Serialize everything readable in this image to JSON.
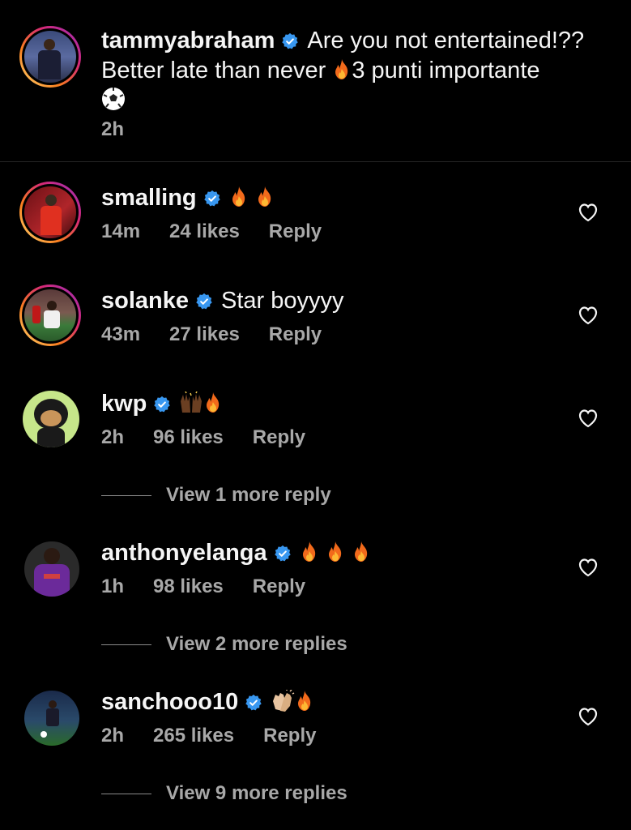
{
  "caption": {
    "username": "tammyabraham",
    "text_line1": "Are you not entertained!??",
    "text_line2a": "Better late than never",
    "text_line2b": "3 punti importante",
    "time": "2h"
  },
  "comments": [
    {
      "username": "smalling",
      "text": "",
      "emojis": [
        "fire-icon",
        "fire-icon"
      ],
      "time": "14m",
      "likes": "24 likes",
      "reply": "Reply"
    },
    {
      "username": "solanke",
      "text": "Star boyyyy",
      "emojis": [],
      "time": "43m",
      "likes": "27 likes",
      "reply": "Reply"
    },
    {
      "username": "kwp",
      "text": "",
      "emojis": [
        "raising-hands-icon",
        "fire-icon"
      ],
      "time": "2h",
      "likes": "96 likes",
      "reply": "Reply",
      "view_more": "View 1 more reply"
    },
    {
      "username": "anthonyelanga",
      "text": "",
      "emojis": [
        "fire-icon",
        "fire-icon",
        "fire-icon"
      ],
      "time": "1h",
      "likes": "98 likes",
      "reply": "Reply",
      "view_more": "View 2 more replies"
    },
    {
      "username": "sanchooo10",
      "text": "",
      "emojis": [
        "clapping-hands-icon",
        "fire-icon"
      ],
      "time": "2h",
      "likes": "265 likes",
      "reply": "Reply",
      "view_more": "View 9 more replies"
    }
  ],
  "colors": {
    "verified": "#3897f0",
    "muted": "#a8a8a8",
    "text": "#f5f5f5"
  }
}
